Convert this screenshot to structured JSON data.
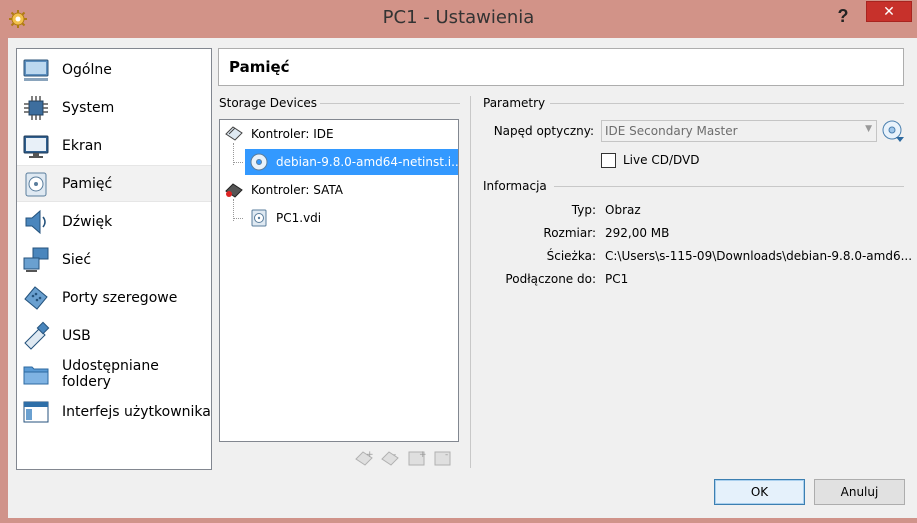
{
  "window": {
    "title": "PC1 - Ustawienia",
    "help_label": "?",
    "close_label": "✕",
    "app_icon": "gear-sun-icon"
  },
  "sidebar": {
    "items": [
      {
        "label": "Ogólne",
        "icon": "monitor-icon"
      },
      {
        "label": "System",
        "icon": "chip-icon"
      },
      {
        "label": "Ekran",
        "icon": "display-icon"
      },
      {
        "label": "Pamięć",
        "icon": "disk-icon",
        "active": true
      },
      {
        "label": "Dźwięk",
        "icon": "speaker-icon"
      },
      {
        "label": "Sieć",
        "icon": "network-icon"
      },
      {
        "label": "Porty szeregowe",
        "icon": "serial-port-icon"
      },
      {
        "label": "USB",
        "icon": "usb-icon"
      },
      {
        "label": "Udostępniane foldery",
        "icon": "folder-icon"
      },
      {
        "label": "Interfejs użytkownika",
        "icon": "window-icon"
      }
    ]
  },
  "section": {
    "title": "Pamięć"
  },
  "storage": {
    "group_label": "Storage Devices",
    "tree": [
      {
        "label": "Kontroler: IDE",
        "level": 0,
        "icon": "ide-controller-icon"
      },
      {
        "label": "debian-9.8.0-amd64-netinst.i...",
        "level": 1,
        "icon": "optical-disc-icon",
        "selected": true
      },
      {
        "label": "Kontroler: SATA",
        "level": 0,
        "icon": "sata-controller-icon"
      },
      {
        "label": "PC1.vdi",
        "level": 1,
        "icon": "hard-disk-icon"
      }
    ],
    "tools": [
      "add-attachment-icon",
      "remove-attachment-icon",
      "add-controller-icon",
      "remove-controller-icon"
    ]
  },
  "parametry": {
    "group_label": "Parametry",
    "drive_label": "Napęd optyczny:",
    "drive_value": "IDE Secondary Master",
    "live_cd_label": "Live CD/DVD",
    "live_cd_checked": false
  },
  "informacja": {
    "group_label": "Informacja",
    "rows": [
      {
        "label": "Typ:",
        "value": "Obraz"
      },
      {
        "label": "Rozmiar:",
        "value": "292,00 MB"
      },
      {
        "label": "Ścieżka:",
        "value": "C:\\Users\\s-115-09\\Downloads\\debian-9.8.0-amd6..."
      },
      {
        "label": "Podłączone do:",
        "value": "PC1"
      }
    ]
  },
  "buttons": {
    "ok": "OK",
    "cancel": "Anuluj"
  },
  "colors": {
    "title_bar": "#d29388",
    "selection": "#3399ff",
    "close": "#c7312b"
  }
}
